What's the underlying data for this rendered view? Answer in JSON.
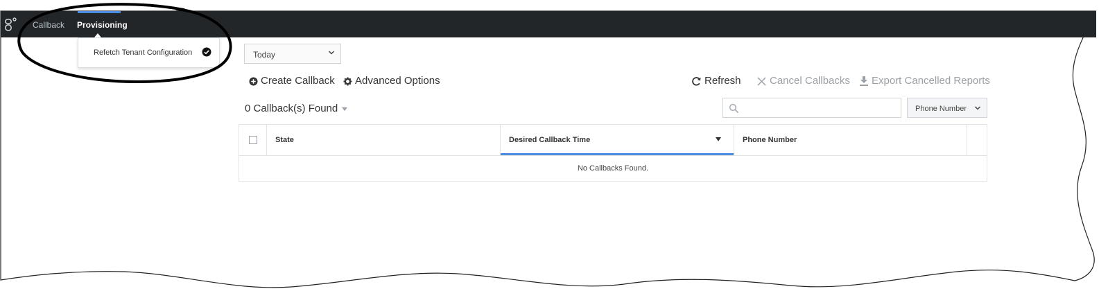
{
  "nav": {
    "items": [
      {
        "label": "Callback",
        "active": false
      },
      {
        "label": "Provisioning",
        "active": true
      }
    ],
    "logo_icon": "genesys-logo-icon"
  },
  "provisioning_menu": {
    "items": [
      {
        "label": "Refetch Tenant Configuration",
        "icon": "check-circle-icon",
        "status": "done"
      }
    ]
  },
  "filters": {
    "date_range": "Today"
  },
  "actions": {
    "create": {
      "label": "Create Callback",
      "icon": "plus-circle-icon"
    },
    "advanced": {
      "label": "Advanced Options",
      "icon": "gear-icon"
    },
    "refresh": {
      "label": "Refresh",
      "icon": "refresh-icon"
    },
    "cancel": {
      "label": "Cancel Callbacks",
      "icon": "close-icon",
      "disabled": true
    },
    "export": {
      "label": "Export Cancelled Reports",
      "icon": "download-icon",
      "disabled": true
    }
  },
  "results": {
    "count_label": "0 Callback(s) Found"
  },
  "search": {
    "placeholder": "",
    "value": "",
    "type": "Phone Number"
  },
  "table": {
    "columns": [
      "State",
      "Desired Callback Time",
      "Phone Number"
    ],
    "sorted_column": "Desired Callback Time",
    "sort_direction": "descending",
    "empty_message": "No Callbacks Found."
  },
  "colors": {
    "topbar": "#232629",
    "accent": "#4c8ce0"
  }
}
